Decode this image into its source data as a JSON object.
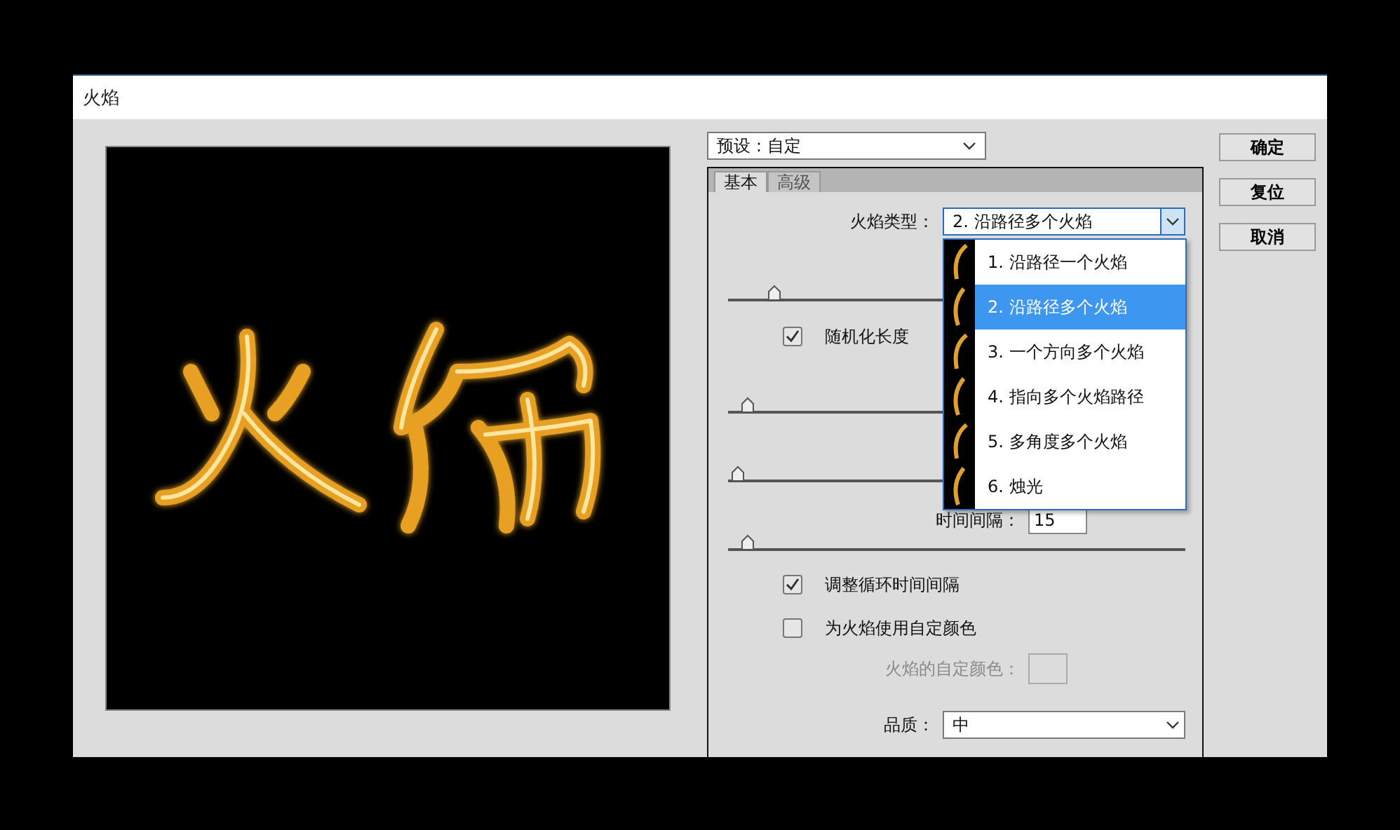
{
  "window": {
    "title": "火焰"
  },
  "preset": {
    "label": "预设：",
    "value": "自定"
  },
  "buttons": [
    "确定",
    "复位",
    "取消"
  ],
  "tabs": [
    {
      "label": "基本",
      "selected": true
    },
    {
      "label": "高级",
      "selected": false
    }
  ],
  "controls": [
    {
      "kind": "select",
      "label": "火焰类型：",
      "value": "2.  沿路径多个火焰",
      "expanded": true
    },
    {
      "kind": "slider",
      "level": 0.09
    },
    {
      "kind": "checkbox",
      "label": "随机化长度",
      "checked": true
    },
    {
      "kind": "slider",
      "level": 0.03
    },
    {
      "kind": "slider",
      "level": 0.01
    },
    {
      "kind": "field",
      "label": "时间间隔：",
      "value": "15"
    },
    {
      "kind": "slider",
      "level": 0.03
    },
    {
      "kind": "checkbox",
      "label": "调整循环时间间隔",
      "checked": true
    },
    {
      "kind": "checkbox",
      "label": "为火焰使用自定颜色",
      "checked": false
    },
    {
      "kind": "swatch",
      "label": "火焰的自定颜色：",
      "disabled": true
    },
    {
      "kind": "select",
      "label": "品质：",
      "value": "中",
      "expanded": false
    }
  ],
  "flame_type_menu": [
    {
      "label": "1.  沿路径一个火焰",
      "selected": false
    },
    {
      "label": "2.  沿路径多个火焰",
      "selected": true
    },
    {
      "label": "3.  一个方向多个火焰",
      "selected": false
    },
    {
      "label": "4.  指向多个火焰路径",
      "selected": false
    },
    {
      "label": "5.  多角度多个火焰",
      "selected": false
    },
    {
      "label": "6.  烛光",
      "selected": false
    }
  ]
}
